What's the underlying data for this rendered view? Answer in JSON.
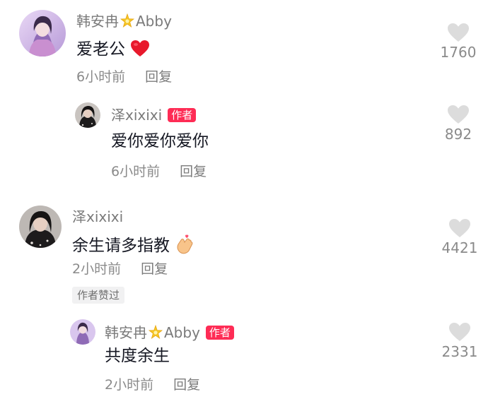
{
  "comments": [
    {
      "username": "韩安冉",
      "username_suffix": "Abby",
      "crown_icon": "crown-icon",
      "content": "爱老公",
      "emoji": "red-heart-icon",
      "time": "6小时前",
      "reply_label": "回复",
      "likes": "1760",
      "replies": [
        {
          "username": "泽xixixi",
          "badge": "作者",
          "content": "爱你爱你爱你",
          "time": "6小时前",
          "reply_label": "回复",
          "likes": "892"
        }
      ]
    },
    {
      "username": "泽xixixi",
      "content": "余生请多指教",
      "emoji": "finger-heart-icon",
      "time": "2小时前",
      "reply_label": "回复",
      "liked_by_author": "作者赞过",
      "likes": "4421",
      "replies": [
        {
          "username": "韩安冉",
          "username_suffix": "Abby",
          "crown_icon": "crown-icon",
          "badge": "作者",
          "content": "共度余生",
          "time": "2小时前",
          "reply_label": "回复",
          "likes": "2331"
        }
      ]
    }
  ],
  "colors": {
    "badge": "#fe2c55",
    "username": "#7a7a7a",
    "content": "#161823",
    "meta": "#8a8a8a",
    "like_icon": "#dcdcdc"
  }
}
